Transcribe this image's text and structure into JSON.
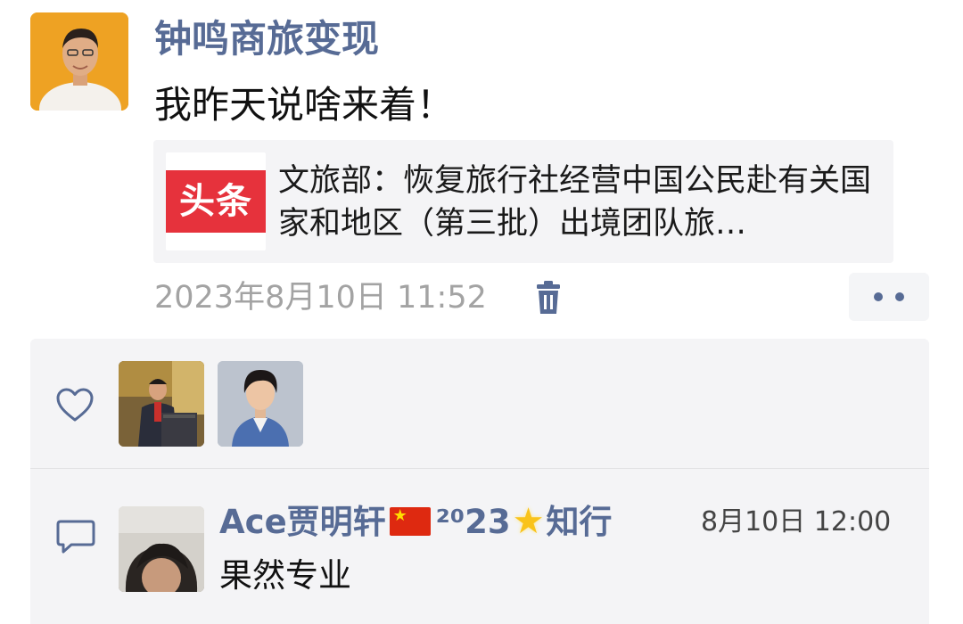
{
  "post": {
    "author_name": "钟鸣商旅变现",
    "text": "我昨天说啥来着！",
    "link_card": {
      "source_logo": "头条",
      "title": "文旅部：恢复旅行社经营中国公民赴有关国家和地区（第三批）出境团队旅…"
    },
    "time": "2023年8月10日 11:52",
    "actions": {
      "delete_icon": "trash-icon",
      "more_icon": "more-dots-icon"
    }
  },
  "likes": {
    "icon": "heart-icon",
    "likers": [
      {
        "avatar": "avatar-man-at-podium"
      },
      {
        "avatar": "avatar-woman-portrait"
      }
    ]
  },
  "comments": [
    {
      "icon": "comment-icon",
      "user_name_prefix": "Ace贾明轩",
      "flag": "china-flag",
      "user_name_middle": "²⁰23",
      "star": "★",
      "user_name_suffix": "知行",
      "time": "8月10日 12:00",
      "text": "果然专业"
    }
  ],
  "colors": {
    "link_blue": "#576b95",
    "card_bg": "#f4f4f6",
    "toutiao_red": "#e6323c",
    "meta_gray": "#a3a3a3"
  }
}
